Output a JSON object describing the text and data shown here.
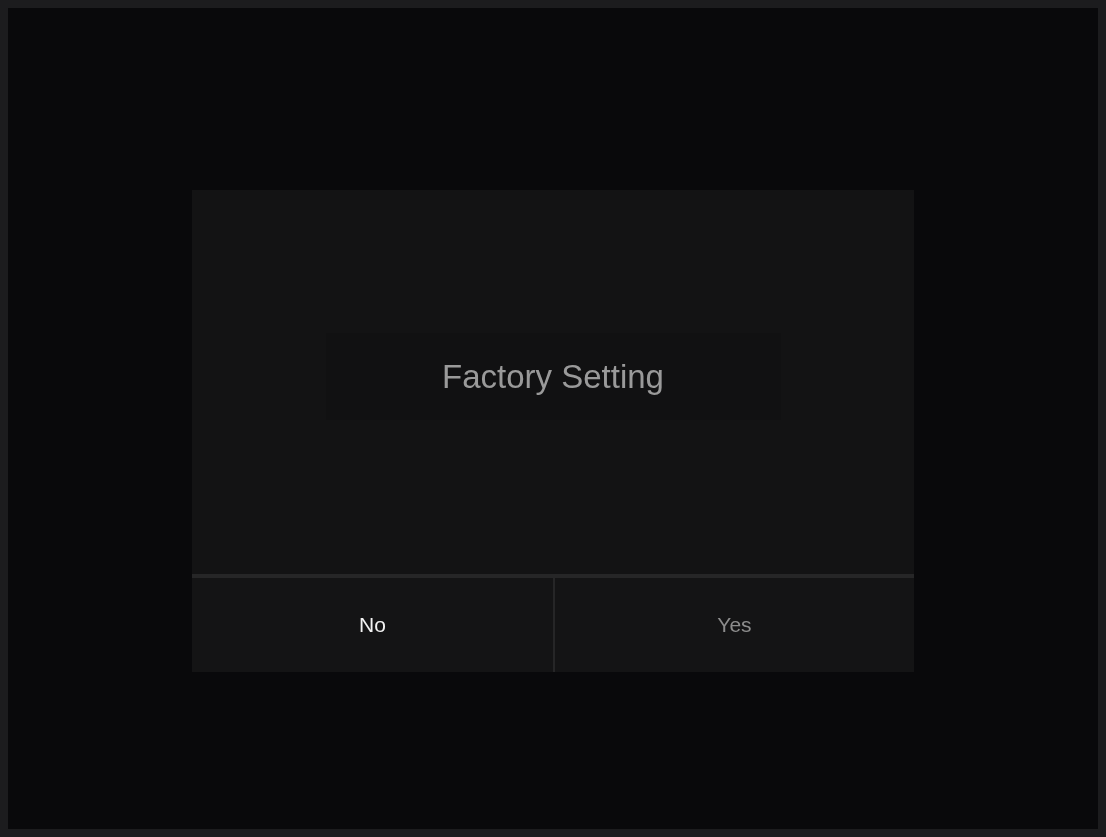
{
  "dialog": {
    "title": "Factory Setting",
    "buttons": [
      {
        "label": "No",
        "selected": true
      },
      {
        "label": "Yes",
        "selected": false
      }
    ]
  }
}
